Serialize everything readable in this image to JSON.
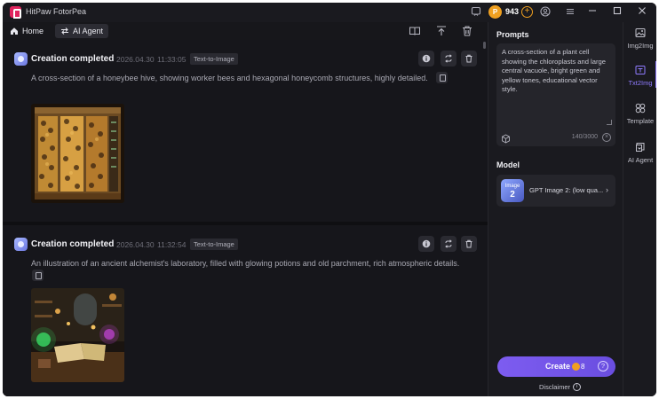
{
  "app": {
    "title": "HitPaw FotorPea",
    "credits": "943",
    "coin_symbol": "P"
  },
  "nav": {
    "home": "Home",
    "agent": "AI Agent"
  },
  "feed": {
    "cards": [
      {
        "title": "Creation completed",
        "date": "2026.04.30",
        "time": "11:33:05",
        "tag": "Text-to-Image",
        "prompt": "A cross-section of a honeybee hive, showing worker bees and hexagonal honeycomb structures, highly detailed."
      },
      {
        "title": "Creation completed",
        "date": "2026.04.30",
        "time": "11:32:54",
        "tag": "Text-to-Image",
        "prompt": "An illustration of an ancient alchemist's laboratory, filled with glowing potions and old parchment, rich atmospheric details."
      }
    ]
  },
  "panel": {
    "prompts_label": "Prompts",
    "prompt_text": "A cross-section of a plant cell showing the chloroplasts and large central vacuole, bright green and yellow tones, educational vector style.",
    "char_count": "140/3000",
    "model_label": "Model",
    "model_thumb_top": "Image",
    "model_thumb_num": "2",
    "model_name": "GPT Image 2: (low qua...",
    "create_label": "Create",
    "create_cost": "8",
    "disclaimer": "Disclaimer"
  },
  "rail": {
    "items": [
      {
        "label": "Img2Img",
        "icon": "image-icon"
      },
      {
        "label": "Txt2Img",
        "icon": "text-image-icon"
      },
      {
        "label": "Template",
        "icon": "template-icon"
      },
      {
        "label": "AI Agent",
        "icon": "agent-icon"
      }
    ]
  },
  "colors": {
    "accent": "#7d5cf0",
    "coin": "#f0a020",
    "background": "#141418"
  }
}
